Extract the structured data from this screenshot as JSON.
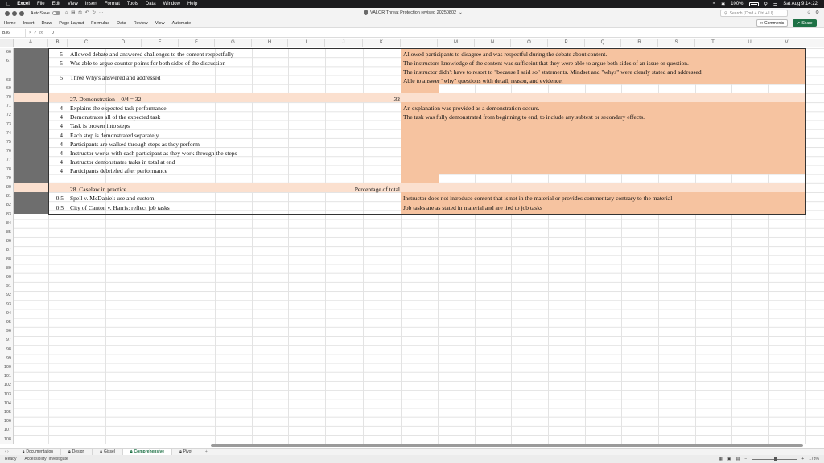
{
  "menubar": {
    "app": "Excel",
    "items": [
      "File",
      "Edit",
      "View",
      "Insert",
      "Format",
      "Tools",
      "Data",
      "Window",
      "Help"
    ],
    "battery": "100%",
    "clock": "Sat Aug 9  14:22"
  },
  "titlebar": {
    "autosave": "AutoSave",
    "doc_title": "VALOR Threat Protection revised 20250802",
    "search_placeholder": "Search (Cmd + Ctrl + U)"
  },
  "ribbon": {
    "tabs": [
      "Home",
      "Insert",
      "Draw",
      "Page Layout",
      "Formulas",
      "Data",
      "Review",
      "View",
      "Automate"
    ],
    "comments": "Comments",
    "share": "Share"
  },
  "formula": {
    "namebox": "B36",
    "value": "0"
  },
  "columns": [
    "A",
    "B",
    "C",
    "D",
    "E",
    "F",
    "G",
    "H",
    "I",
    "J",
    "K",
    "L",
    "M",
    "N",
    "O",
    "P",
    "Q",
    "R",
    "S",
    "T",
    "U",
    "V"
  ],
  "rows": {
    "numbers": [
      "66",
      "67",
      "68",
      "69",
      "70",
      "71",
      "72",
      "73",
      "74",
      "75",
      "76",
      "77",
      "78",
      "79",
      "80",
      "81",
      "82",
      "83",
      "84",
      "85",
      "86",
      "87",
      "88",
      "89",
      "90",
      "91",
      "92",
      "93",
      "94",
      "95",
      "96",
      "97",
      "98",
      "99",
      "100",
      "101",
      "102",
      "103",
      "104",
      "105",
      "106",
      "107",
      "108"
    ]
  },
  "sheet": {
    "r66": {
      "b": "5",
      "c": "Allowed debate and answered challenges to the content respectfully",
      "l": "Allowed participants to disagree and was respectful during the debate about content."
    },
    "r67": {
      "b": "5",
      "c": "Was able to argue counter-points for both sides of the discussion",
      "l": "The instructors knowledge of the content was sufficeint that they were able to argue both sides of an issue or question."
    },
    "r68": {
      "b": "5",
      "c": "Three Why's answered and addressed",
      "l1": "The instructor didn't have to resort to \"because I said so\" statements. Mindset and \"whys\" were clearly stated and addressed.",
      "l2": "Able to answer \"why\" questions with detail, reason, and evidence."
    },
    "r70": {
      "c": "27.  Demonstration – 0/4 = 32",
      "k": "32"
    },
    "r71": {
      "b": "4",
      "c": "Explains the expected task performance",
      "l": "An explanation was provided as a demonstration occurs."
    },
    "r72": {
      "b": "4",
      "c": "Demonstrates all of the expected task",
      "l": "The task was fully demonstrated from beginning to end, to include any subtext or secondary effects."
    },
    "r73": {
      "b": "4",
      "c": "Task is broken into steps"
    },
    "r74": {
      "b": "4",
      "c": "Each step is demonstrated separately"
    },
    "r75": {
      "b": "4",
      "c": "Participants are walked through steps as they perform"
    },
    "r76": {
      "b": "4",
      "c": "Instructor works with each participant as they work through the steps"
    },
    "r77": {
      "b": "4",
      "c": "Instructor demonstrates tasks in total at end"
    },
    "r78": {
      "b": "4",
      "c": "Participants debriefed after performance"
    },
    "r80": {
      "c": "28. Caselaw in practice",
      "j": "Percentage of total"
    },
    "r81": {
      "b": "0.5",
      "c": "Spell v. McDaniel: use and custom",
      "l": "Instructor does not introduce content that is not in the material or provides commentary contrary to the material"
    },
    "r82": {
      "b": "0.5",
      "c": "City of Canton v. Harris: reflect job tasks",
      "l": "Job tasks are as stated in material and are tied to job tasks"
    }
  },
  "sheet_tabs": [
    "Documentation",
    "Design",
    "Gissel",
    "Comprehensive",
    "Pivot"
  ],
  "active_sheet": "Comprehensive",
  "status": {
    "ready": "Ready",
    "accessibility": "Accessibility: Investigate",
    "zoom": "173%"
  },
  "colors": {
    "peach": "#f6c3a0",
    "light_peach": "#fbe0cf",
    "dark_gray": "#6e6e6e",
    "excel_green": "#1e7145"
  }
}
